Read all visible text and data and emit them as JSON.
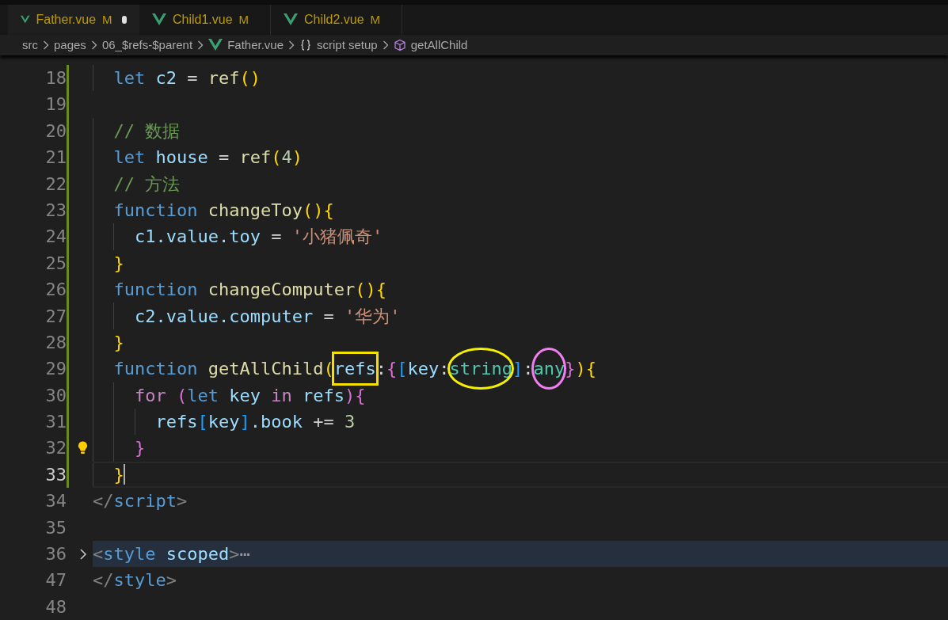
{
  "tabs": [
    {
      "label": "Father.vue",
      "status": "M",
      "selected": true,
      "unsaved": true
    },
    {
      "label": "Child1.vue",
      "status": "M",
      "selected": false,
      "unsaved": false
    },
    {
      "label": "Child2.vue",
      "status": "M",
      "selected": false,
      "unsaved": false
    }
  ],
  "breadcrumb": [
    {
      "label": "src",
      "kind": "folder"
    },
    {
      "label": "pages",
      "kind": "folder"
    },
    {
      "label": "06_$refs-$parent",
      "kind": "folder"
    },
    {
      "label": "Father.vue",
      "kind": "vue"
    },
    {
      "label": "script setup",
      "kind": "braces"
    },
    {
      "label": "getAllChild",
      "kind": "method"
    }
  ],
  "lines": [
    {
      "number": "18",
      "modified": true,
      "current": false,
      "folded": false,
      "bulb": false,
      "tokens": [
        {
          "kind": "keyword",
          "text": "  let"
        },
        {
          "kind": "variable",
          "text": " c2"
        },
        {
          "kind": "operator",
          "text": " = "
        },
        {
          "kind": "function",
          "text": "ref"
        },
        {
          "kind": "bracket1",
          "text": "()"
        }
      ]
    },
    {
      "number": "19",
      "modified": true,
      "current": false,
      "folded": false,
      "bulb": false
    },
    {
      "number": "20",
      "modified": true,
      "current": false,
      "folded": false,
      "bulb": false,
      "tokens": [
        {
          "kind": "comment",
          "text": "  // 数据"
        }
      ]
    },
    {
      "number": "21",
      "modified": true,
      "current": false,
      "folded": false,
      "bulb": false,
      "tokens": [
        {
          "kind": "keyword",
          "text": "  let"
        },
        {
          "kind": "variable",
          "text": " house"
        },
        {
          "kind": "operator",
          "text": " = "
        },
        {
          "kind": "function",
          "text": "ref"
        },
        {
          "kind": "bracket1",
          "text": "("
        },
        {
          "kind": "number",
          "text": "4"
        },
        {
          "kind": "bracket1",
          "text": ")"
        }
      ]
    },
    {
      "number": "22",
      "modified": true,
      "current": false,
      "folded": false,
      "bulb": false,
      "tokens": [
        {
          "kind": "comment",
          "text": "  // 方法"
        }
      ]
    },
    {
      "number": "23",
      "modified": true,
      "current": false,
      "folded": false,
      "bulb": false,
      "tokens": [
        {
          "kind": "keyword",
          "text": "  function"
        },
        {
          "kind": "function",
          "text": " changeToy"
        },
        {
          "kind": "bracket1",
          "text": "(){"
        }
      ]
    },
    {
      "number": "24",
      "modified": true,
      "current": false,
      "folded": false,
      "bulb": false,
      "tokens": [
        {
          "kind": "variable",
          "text": "    c1.value.toy"
        },
        {
          "kind": "operator",
          "text": " = "
        },
        {
          "kind": "string",
          "text": "'小猪佩奇'"
        }
      ]
    },
    {
      "number": "25",
      "modified": true,
      "current": false,
      "folded": false,
      "bulb": false,
      "tokens": [
        {
          "kind": "bracket1",
          "text": "  }"
        }
      ]
    },
    {
      "number": "26",
      "modified": true,
      "current": false,
      "folded": false,
      "bulb": false,
      "tokens": [
        {
          "kind": "keyword",
          "text": "  function"
        },
        {
          "kind": "function",
          "text": " changeComputer"
        },
        {
          "kind": "bracket1",
          "text": "(){"
        }
      ]
    },
    {
      "number": "27",
      "modified": true,
      "current": false,
      "folded": false,
      "bulb": false,
      "tokens": [
        {
          "kind": "variable",
          "text": "    c2.value.computer"
        },
        {
          "kind": "operator",
          "text": " = "
        },
        {
          "kind": "string",
          "text": "'华为'"
        }
      ]
    },
    {
      "number": "28",
      "modified": true,
      "current": false,
      "folded": false,
      "bulb": false,
      "tokens": [
        {
          "kind": "bracket1",
          "text": "  }"
        }
      ]
    },
    {
      "number": "29",
      "modified": true,
      "current": false,
      "folded": false,
      "bulb": false,
      "tokens": [
        {
          "kind": "keyword",
          "text": "  function"
        },
        {
          "kind": "function",
          "text": " getAllChild"
        },
        {
          "kind": "bracket1",
          "text": "("
        },
        {
          "kind": "variable",
          "text": "refs",
          "mark": {
            "kind": "box",
            "color": "#f5e000"
          }
        },
        {
          "kind": "operator",
          "text": ":"
        },
        {
          "kind": "bracket2",
          "text": "{"
        },
        {
          "kind": "bracket3",
          "text": "["
        },
        {
          "kind": "variable",
          "text": "key"
        },
        {
          "kind": "operator",
          "text": ":"
        },
        {
          "kind": "type",
          "text": "string",
          "mark": {
            "kind": "ellipse",
            "color": "#f5f000"
          }
        },
        {
          "kind": "bracket3",
          "text": "]"
        },
        {
          "kind": "operator",
          "text": ":"
        },
        {
          "kind": "type",
          "text": "any",
          "mark": {
            "kind": "ellipse",
            "color": "#f07ef0"
          }
        },
        {
          "kind": "bracket2",
          "text": "}"
        },
        {
          "kind": "bracket1",
          "text": "){"
        }
      ]
    },
    {
      "number": "30",
      "modified": true,
      "current": false,
      "folded": false,
      "bulb": false,
      "tokens": [
        {
          "kind": "control",
          "text": "    for"
        },
        {
          "kind": "bracket2",
          "text": " ("
        },
        {
          "kind": "keyword",
          "text": "let"
        },
        {
          "kind": "variable",
          "text": " key"
        },
        {
          "kind": "control",
          "text": " in"
        },
        {
          "kind": "variable",
          "text": " refs"
        },
        {
          "kind": "bracket2",
          "text": "){"
        }
      ]
    },
    {
      "number": "31",
      "modified": true,
      "current": false,
      "folded": false,
      "bulb": false,
      "tokens": [
        {
          "kind": "variable",
          "text": "      refs"
        },
        {
          "kind": "bracket3",
          "text": "["
        },
        {
          "kind": "variable",
          "text": "key"
        },
        {
          "kind": "bracket3",
          "text": "]"
        },
        {
          "kind": "variable",
          "text": ".book"
        },
        {
          "kind": "operator",
          "text": " += "
        },
        {
          "kind": "number",
          "text": "3"
        }
      ]
    },
    {
      "number": "32",
      "modified": true,
      "current": false,
      "folded": false,
      "bulb": true,
      "tokens": [
        {
          "kind": "bracket2",
          "text": "    }"
        }
      ]
    },
    {
      "number": "33",
      "modified": true,
      "current": true,
      "folded": false,
      "bulb": false,
      "tokens": [
        {
          "kind": "bracket1",
          "text": "  }"
        }
      ]
    },
    {
      "number": "34",
      "modified": false,
      "current": false,
      "folded": false,
      "bulb": false,
      "tokens": [
        {
          "kind": "tagbracket",
          "text": "</"
        },
        {
          "kind": "tag",
          "text": "script"
        },
        {
          "kind": "tagbracket",
          "text": ">"
        }
      ]
    },
    {
      "number": "35",
      "modified": false,
      "current": false,
      "folded": false,
      "bulb": false
    },
    {
      "number": "36",
      "modified": false,
      "current": false,
      "folded": true,
      "bulb": false,
      "tokens": [
        {
          "kind": "tagbracket",
          "text": "<"
        },
        {
          "kind": "tag",
          "text": "style"
        },
        {
          "kind": "attribute",
          "text": " scoped"
        },
        {
          "kind": "tagbracket",
          "text": ">"
        },
        {
          "kind": "ellipsis",
          "text": "⋯"
        }
      ]
    },
    {
      "number": "47",
      "modified": false,
      "current": false,
      "folded": false,
      "bulb": false,
      "tokens": [
        {
          "kind": "tagbracket",
          "text": "</"
        },
        {
          "kind": "tag",
          "text": "style"
        },
        {
          "kind": "tagbracket",
          "text": ">"
        }
      ]
    },
    {
      "number": "48",
      "modified": false,
      "current": false,
      "folded": false,
      "bulb": false
    }
  ]
}
